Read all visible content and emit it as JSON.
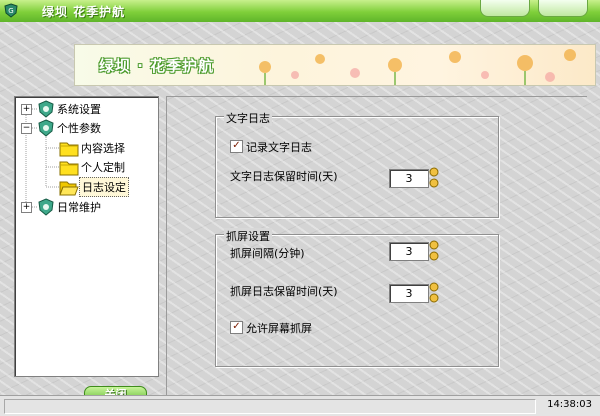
{
  "window": {
    "title": "绿坝 花季护航"
  },
  "banner": {
    "text": "绿坝 · 花季护航"
  },
  "tree": {
    "items": [
      {
        "label": "系统设置",
        "level": 0,
        "expander": "+"
      },
      {
        "label": "个性参数",
        "level": 0,
        "expander": "−"
      },
      {
        "label": "内容选择",
        "level": 1
      },
      {
        "label": "个人定制",
        "level": 1
      },
      {
        "label": "日志设定",
        "level": 1,
        "selected": true
      },
      {
        "label": "日常维护",
        "level": 0,
        "expander": "+"
      }
    ]
  },
  "buttons": {
    "close": "关闭"
  },
  "text_log": {
    "title": "文字日志",
    "record_label": "记录文字日志",
    "record_checked": true,
    "retention_label": "文字日志保留时间(天)",
    "retention_value": "3"
  },
  "screenshot": {
    "title": "抓屏设置",
    "interval_label": "抓屏间隔(分钟)",
    "interval_value": "3",
    "retention_label": "抓屏日志保留时间(天)",
    "retention_value": "3",
    "allow_label": "允许屏幕抓屏",
    "allow_checked": true
  },
  "status": {
    "time": "14:38:03"
  },
  "colors": {
    "accent": "#7fcf3a",
    "check": "#7a1a00"
  }
}
